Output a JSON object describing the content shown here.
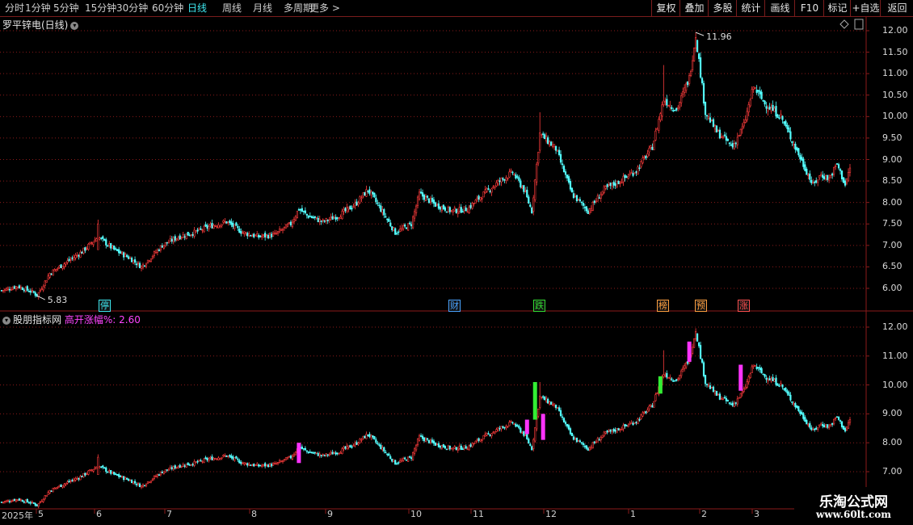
{
  "topbar": {
    "periods": [
      "分时",
      "1分钟",
      "5分钟",
      "15分钟",
      "30分钟",
      "60分钟",
      "日线",
      "周线",
      "月线",
      "多周期",
      "更多 >"
    ],
    "active": "日线",
    "right_buttons": [
      "复权",
      "叠加",
      "多股",
      "统计",
      "画线",
      "F10",
      "标记",
      "+自选",
      "返回"
    ]
  },
  "upper": {
    "title": "罗平锌电(日线)",
    "high_label": "11.96",
    "low_label": "5.83",
    "y_ticks": [
      "12.00",
      "11.50",
      "11.00",
      "10.50",
      "10.00",
      "9.50",
      "9.00",
      "8.50",
      "8.00",
      "7.50",
      "7.00",
      "6.50",
      "6.00"
    ]
  },
  "lower": {
    "title": "股朋指标网",
    "indicator_name": "高开涨幅%:",
    "indicator_value": "2.60",
    "y_ticks": [
      "12.00",
      "11.00",
      "10.00",
      "9.00",
      "8.00",
      "7.00"
    ]
  },
  "event_markers": [
    {
      "text": "停",
      "color": "#3ee8f0"
    },
    {
      "text": "财",
      "color": "#4aa3ff"
    },
    {
      "text": "跌",
      "color": "#33dd33"
    },
    {
      "text": "榜",
      "color": "#ffa040"
    },
    {
      "text": "预",
      "color": "#ffa040"
    },
    {
      "text": "涨",
      "color": "#ff5050"
    }
  ],
  "x_axis": [
    "2025年",
    "5",
    "6",
    "7",
    "8",
    "9",
    "10",
    "11",
    "12",
    "1",
    "2",
    "3"
  ],
  "watermark": {
    "line1": "乐淘公式网",
    "line2": "www.60lt.com"
  },
  "colors": {
    "up": "#ff3c3c",
    "down": "#54ffff",
    "grid": "#8b1a1a",
    "highlight_magenta": "#ff33ff",
    "highlight_green": "#33ee33"
  },
  "chart_data": {
    "type": "candlestick",
    "title": "罗平锌电(日线)",
    "ylim_upper": [
      5.5,
      12.3
    ],
    "ylim_lower": [
      6.5,
      12.4
    ],
    "anchors": [
      [
        0,
        5.95
      ],
      [
        10,
        6.05
      ],
      [
        20,
        5.9
      ],
      [
        22,
        5.83
      ],
      [
        30,
        6.35
      ],
      [
        40,
        6.6
      ],
      [
        50,
        6.85
      ],
      [
        60,
        7.2
      ],
      [
        65,
        7.05
      ],
      [
        70,
        6.9
      ],
      [
        80,
        6.7
      ],
      [
        87,
        6.5
      ],
      [
        100,
        7.0
      ],
      [
        110,
        7.2
      ],
      [
        120,
        7.3
      ],
      [
        130,
        7.45
      ],
      [
        140,
        7.55
      ],
      [
        150,
        7.3
      ],
      [
        160,
        7.2
      ],
      [
        170,
        7.25
      ],
      [
        180,
        7.5
      ],
      [
        185,
        7.85
      ],
      [
        190,
        7.7
      ],
      [
        200,
        7.55
      ],
      [
        210,
        7.7
      ],
      [
        220,
        7.95
      ],
      [
        228,
        8.3
      ],
      [
        235,
        7.9
      ],
      [
        245,
        7.3
      ],
      [
        255,
        7.5
      ],
      [
        260,
        8.2
      ],
      [
        270,
        7.95
      ],
      [
        280,
        7.8
      ],
      [
        290,
        7.85
      ],
      [
        300,
        8.2
      ],
      [
        310,
        8.5
      ],
      [
        318,
        8.7
      ],
      [
        325,
        8.3
      ],
      [
        330,
        7.8
      ],
      [
        335,
        9.6
      ],
      [
        345,
        9.25
      ],
      [
        355,
        8.2
      ],
      [
        365,
        7.8
      ],
      [
        375,
        8.3
      ],
      [
        385,
        8.5
      ],
      [
        395,
        8.75
      ],
      [
        405,
        9.3
      ],
      [
        412,
        10.4
      ],
      [
        420,
        10.15
      ],
      [
        428,
        10.9
      ],
      [
        432,
        11.9
      ],
      [
        438,
        10.1
      ],
      [
        445,
        9.65
      ],
      [
        455,
        9.3
      ],
      [
        462,
        9.8
      ],
      [
        468,
        10.7
      ],
      [
        475,
        10.3
      ],
      [
        485,
        10.0
      ],
      [
        495,
        9.2
      ],
      [
        505,
        8.4
      ],
      [
        510,
        8.65
      ],
      [
        515,
        8.55
      ],
      [
        520,
        8.9
      ],
      [
        525,
        8.4
      ],
      [
        528,
        8.8
      ]
    ],
    "highlights": [
      {
        "bar": 185,
        "color": "magenta",
        "high": 8.0,
        "low": 7.3
      },
      {
        "bar": 327,
        "color": "magenta",
        "high": 8.8,
        "low": 8.3
      },
      {
        "bar": 332,
        "color": "green",
        "high": 10.1,
        "low": 8.8
      },
      {
        "bar": 337,
        "color": "magenta",
        "high": 9.0,
        "low": 8.1
      },
      {
        "bar": 410,
        "color": "green",
        "high": 10.3,
        "low": 9.7
      },
      {
        "bar": 428,
        "color": "magenta",
        "high": 11.5,
        "low": 10.8
      },
      {
        "bar": 460,
        "color": "magenta",
        "high": 10.7,
        "low": 9.8
      }
    ],
    "high": 11.96,
    "low": 5.83
  }
}
